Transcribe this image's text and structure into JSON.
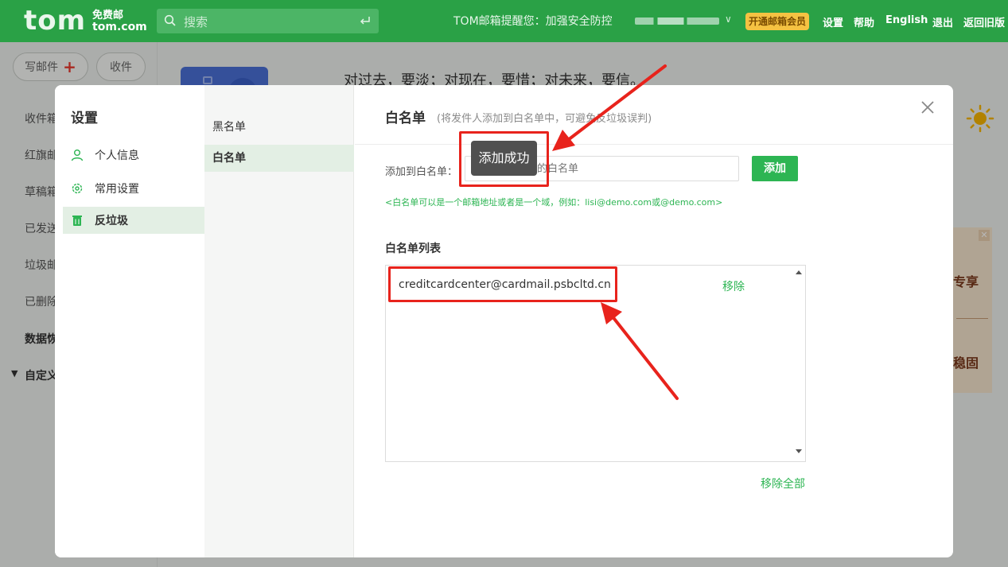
{
  "header": {
    "logo": "tom",
    "logo_line1": "免费邮",
    "logo_line2": "tom.com",
    "search_placeholder": "搜索",
    "notice": "TOM邮箱提醒您：加强安全防控",
    "vip_button": "开通邮箱会员",
    "links": [
      "设置",
      "帮助",
      "English",
      "退出",
      "返回旧版"
    ]
  },
  "mail": {
    "compose": "写邮件",
    "receive": "收件",
    "folders": [
      "收件箱",
      "红旗邮件",
      "草稿箱",
      "已发送",
      "垃圾邮件",
      "已删除"
    ],
    "folders_bold": [
      "数据恢复",
      "自定义"
    ],
    "motto": "对过去，要淡；对现在，要惜；对未来，要信。",
    "promo_line1": "专享",
    "promo_line2": "稳固"
  },
  "settings": {
    "title": "设置",
    "nav": [
      "个人信息",
      "常用设置",
      "反垃圾"
    ],
    "subnav": [
      "黑名单",
      "白名单"
    ],
    "whitelist": {
      "title": "白名单",
      "subtitle": "(将发件人添加到白名单中，可避免反垃圾误判)",
      "add_label": "添加到白名单：",
      "input_placeholder": "请输入要添加的白名单",
      "add_button": "添加",
      "hint": "<白名单可以是一个邮箱地址或者是一个域，例如：lisi@demo.com或@demo.com>",
      "list_title": "白名单列表",
      "entries": [
        {
          "address": "creditcardcenter@cardmail.psbcltd.cn",
          "action": "移除"
        }
      ],
      "remove_all": "移除全部"
    },
    "toast": "添加成功"
  },
  "colors": {
    "brand_green": "#2aa146",
    "accent_green": "#2db553",
    "annotation_red": "#e8231c",
    "vip_gold": "#f5c242"
  }
}
